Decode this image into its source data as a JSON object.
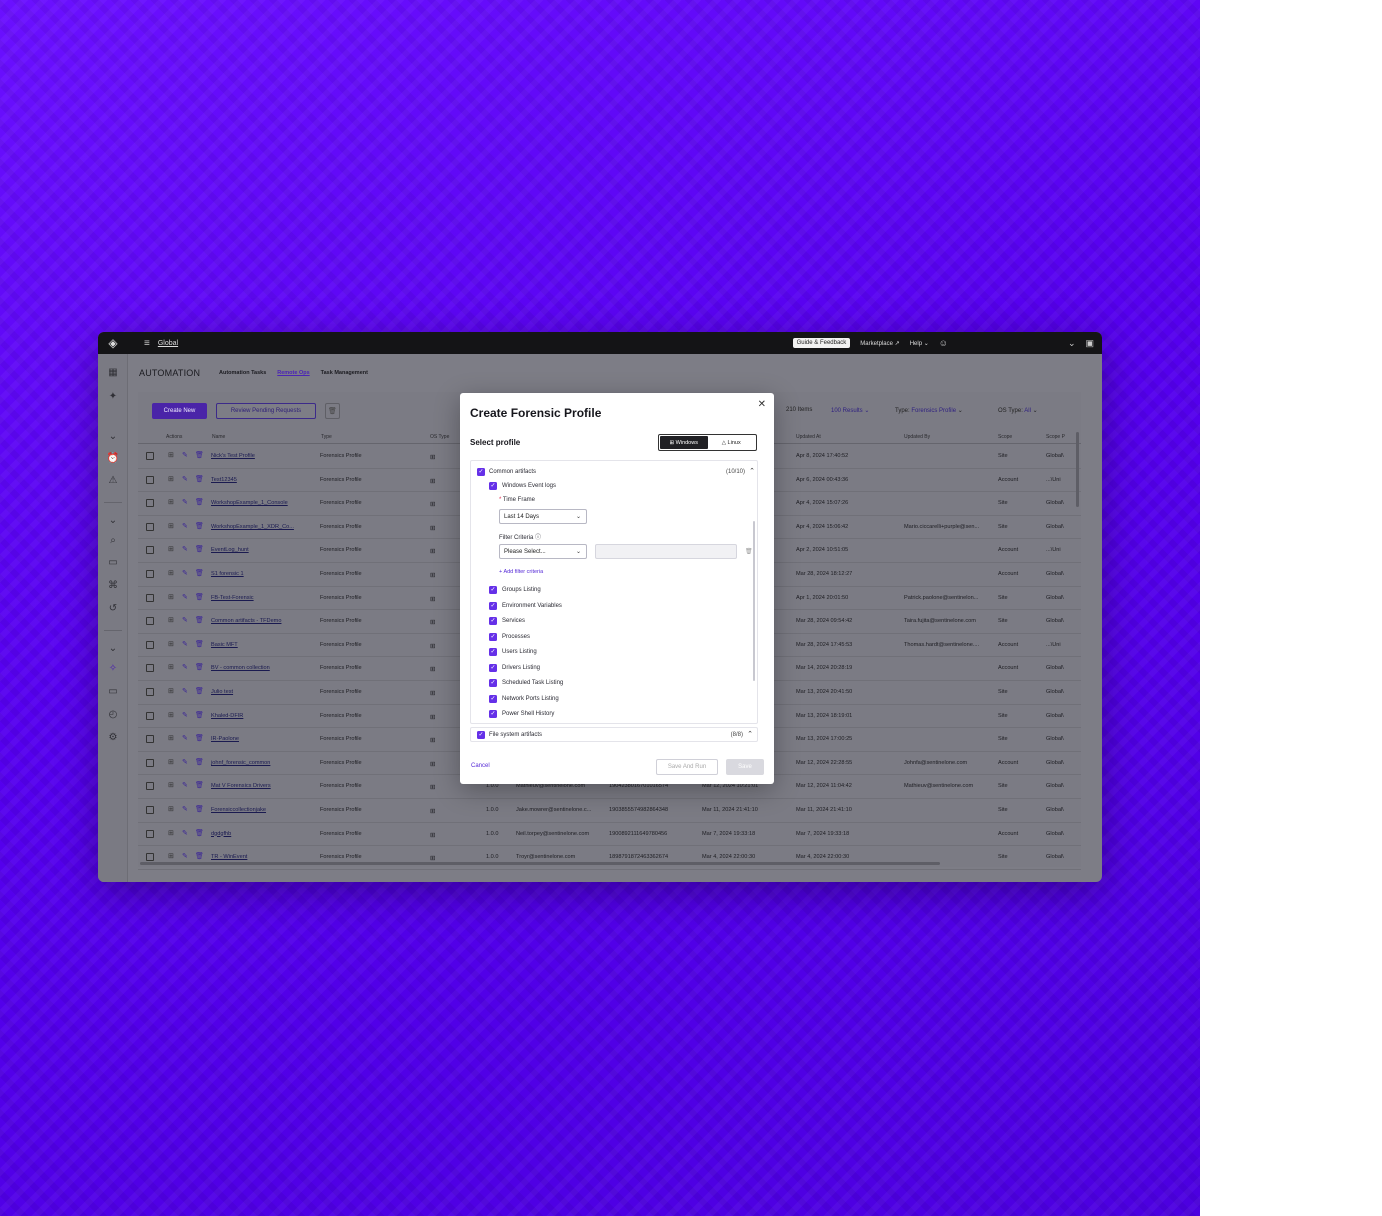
{
  "topbar": {
    "scope": "Global",
    "guide_label": "Guide & Feedback",
    "marketplace_label": "Marketplace",
    "help_label": "Help"
  },
  "page": {
    "title": "AUTOMATION",
    "tabs": [
      "Automation Tasks",
      "Remote Ops",
      "Task Management"
    ]
  },
  "toolbar": {
    "create_label": "Create New",
    "review_label": "Review Pending Requests",
    "items_count": "210 Items",
    "results_label": "100 Results",
    "type_label": "Type:",
    "type_value": "Forensics Profile",
    "os_type_label": "OS Type:",
    "os_type_value": "All"
  },
  "table": {
    "headers": {
      "actions": "Actions",
      "name": "Name",
      "type": "Type",
      "os_type": "OS Type",
      "updated_at": "Updated At",
      "updated_by": "Updated By",
      "scope": "Scope",
      "scope_path": "Scope P"
    },
    "rows": [
      {
        "name": "Nick's Test Profile",
        "type": "Forensics Profile",
        "version": "",
        "created_by": "",
        "id": "",
        "created_at": "",
        "updated_at": "Apr 8, 2024 17:40:52",
        "updated_by": "",
        "scope": "Site",
        "path": "Global\\"
      },
      {
        "name": "Test12345",
        "type": "Forensics Profile",
        "version": "",
        "created_by": "",
        "id": "",
        "created_at": "",
        "updated_at": "Apr 6, 2024 00:43:36",
        "updated_by": "",
        "scope": "Account",
        "path": "...\\Uni"
      },
      {
        "name": "WorkshopExample_1_Console",
        "type": "Forensics Profile",
        "version": "",
        "created_by": "",
        "id": "",
        "created_at": "",
        "updated_at": "Apr 4, 2024 15:07:26",
        "updated_by": "",
        "scope": "Site",
        "path": "Global\\"
      },
      {
        "name": "WorkshopExample_1_XDR_Co...",
        "type": "Forensics Profile",
        "version": "",
        "created_by": "",
        "id": "",
        "created_at": "",
        "updated_at": "Apr 4, 2024 15:06:42",
        "updated_by": "Mario.ciccarelli+purple@sen...",
        "scope": "Site",
        "path": "Global\\"
      },
      {
        "name": "EventLog_hunt",
        "type": "Forensics Profile",
        "version": "",
        "created_by": "",
        "id": "",
        "created_at": "",
        "updated_at": "Apr 2, 2024 10:51:05",
        "updated_by": "",
        "scope": "Account",
        "path": "...\\Uni"
      },
      {
        "name": "S1 forensic 1",
        "type": "Forensics Profile",
        "version": "",
        "created_by": "",
        "id": "",
        "created_at": "",
        "updated_at": "Mar 28, 2024 18:12:27",
        "updated_by": "",
        "scope": "Account",
        "path": "Global\\"
      },
      {
        "name": "FB-Test-Forensic",
        "type": "Forensics Profile",
        "version": "",
        "created_by": "",
        "id": "",
        "created_at": "",
        "updated_at": "Apr 1, 2024 20:01:50",
        "updated_by": "Patrick.paolone@sentinelon...",
        "scope": "Site",
        "path": "Global\\"
      },
      {
        "name": "Common artifacts - TFDemo",
        "type": "Forensics Profile",
        "version": "",
        "created_by": "",
        "id": "",
        "created_at": "",
        "updated_at": "Mar 28, 2024 09:54:42",
        "updated_by": "Taira.fujita@sentinelone.com",
        "scope": "Site",
        "path": "Global\\"
      },
      {
        "name": "Basic MFT",
        "type": "Forensics Profile",
        "version": "",
        "created_by": "",
        "id": "",
        "created_at": "",
        "updated_at": "Mar 28, 2024 17:45:53",
        "updated_by": "Thomas.hardt@sentinelone....",
        "scope": "Account",
        "path": "...\\Uni"
      },
      {
        "name": "BV - common collection",
        "type": "Forensics Profile",
        "version": "",
        "created_by": "",
        "id": "",
        "created_at": "",
        "updated_at": "Mar 14, 2024 20:28:19",
        "updated_by": "",
        "scope": "Account",
        "path": "Global\\"
      },
      {
        "name": "Julio test",
        "type": "Forensics Profile",
        "version": "",
        "created_by": "",
        "id": "",
        "created_at": "",
        "updated_at": "Mar 13, 2024 20:41:50",
        "updated_by": "",
        "scope": "Site",
        "path": "Global\\"
      },
      {
        "name": "Khaled-DFIR",
        "type": "Forensics Profile",
        "version": "",
        "created_by": "",
        "id": "",
        "created_at": "",
        "updated_at": "Mar 13, 2024 18:19:01",
        "updated_by": "",
        "scope": "Site",
        "path": "Global\\"
      },
      {
        "name": "IR-Paolone",
        "type": "Forensics Profile",
        "version": "",
        "created_by": "",
        "id": "",
        "created_at": "",
        "updated_at": "Mar 13, 2024 17:00:25",
        "updated_by": "",
        "scope": "Site",
        "path": "Global\\"
      },
      {
        "name": "johnf_forensic_common",
        "type": "Forensics Profile",
        "version": "",
        "created_by": "",
        "id": "",
        "created_at": "",
        "updated_at": "Mar 12, 2024 22:28:55",
        "updated_by": "Johnfa@sentinelone.com",
        "scope": "Account",
        "path": "Global\\"
      },
      {
        "name": "Mat V Forensics Drivers",
        "type": "Forensics Profile",
        "version": "1.0.0",
        "created_by": "Mathieuv@sentinelone.com",
        "id": "1904238016701016574",
        "created_at": "Mar 12, 2024 10:21:01",
        "updated_at": "Mar 12, 2024 11:04:42",
        "updated_by": "Mathieuv@sentinelone.com",
        "scope": "Site",
        "path": "Global\\"
      },
      {
        "name": "Forensiccollectionjake",
        "type": "Forensics Profile",
        "version": "1.0.0",
        "created_by": "Jake.mowrer@sentinelone.c...",
        "id": "1903855574982864348",
        "created_at": "Mar 11, 2024 21:41:10",
        "updated_at": "Mar 11, 2024 21:41:10",
        "updated_by": "",
        "scope": "Site",
        "path": "Global\\"
      },
      {
        "name": "dgdgfhb",
        "type": "Forensics Profile",
        "version": "1.0.0",
        "created_by": "Neil.torpey@sentinelone.com",
        "id": "1900892111649780456",
        "created_at": "Mar 7, 2024 19:33:18",
        "updated_at": "Mar 7, 2024 19:33:18",
        "updated_by": "",
        "scope": "Account",
        "path": "Global\\"
      },
      {
        "name": "TR - WinEvent",
        "type": "Forensics Profile",
        "version": "1.0.0",
        "created_by": "Troyr@sentinelone.com",
        "id": "1898791872463362674",
        "created_at": "Mar 4, 2024 22:00:30",
        "updated_at": "Mar 4, 2024 22:00:30",
        "updated_by": "",
        "scope": "Site",
        "path": "Global\\"
      }
    ]
  },
  "modal": {
    "title": "Create Forensic Profile",
    "select_label": "Select profile",
    "os_options": [
      "Windows",
      "Linux"
    ],
    "common_group": {
      "label": "Common artifacts",
      "count": "(10/10)"
    },
    "event_logs_label": "Windows Event logs",
    "time_frame_label": "Time Frame",
    "time_frame_value": "Last 14 Days",
    "filter_criteria_label": "Filter Criteria",
    "filter_placeholder": "Please Select...",
    "add_filter_label": "Add filter criteria",
    "items": [
      "Groups Listing",
      "Environment Variables",
      "Services",
      "Processes",
      "Users Listing",
      "Drivers Listing",
      "Scheduled Task Listing",
      "Network Ports Listing",
      "Power Shell History"
    ],
    "fs_group": {
      "label": "File system artifacts",
      "count": "(8/8)"
    },
    "cancel_label": "Cancel",
    "save_run_label": "Save And Run",
    "save_label": "Save"
  }
}
